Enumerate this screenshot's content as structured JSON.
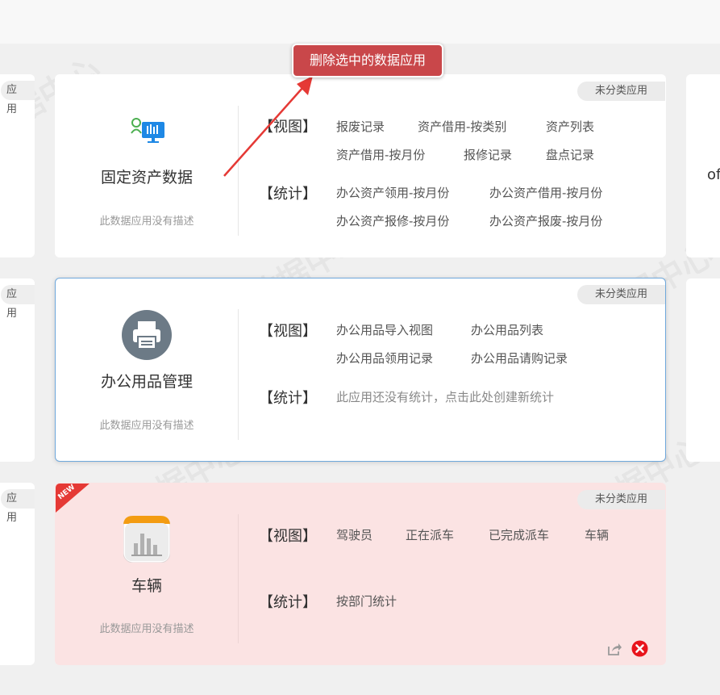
{
  "tooltip": {
    "label": "删除选中的数据应用"
  },
  "side": {
    "tag_partial": "应用",
    "right_text_partial": "of"
  },
  "watermark_text": "数据中心",
  "cards": [
    {
      "name": "固定资产数据",
      "desc": "此数据应用没有描述",
      "tag": "未分类应用",
      "view_label": "【视图】",
      "stat_label": "【统计】",
      "views": [
        "报废记录",
        "资产借用-按类别",
        "资产列表",
        "资产借用-按月份",
        "报修记录",
        "盘点记录"
      ],
      "stats": [
        "办公资产领用-按月份",
        "办公资产借用-按月份",
        "办公资产报修-按月份",
        "办公资产报废-按月份"
      ]
    },
    {
      "name": "办公用品管理",
      "desc": "此数据应用没有描述",
      "tag": "未分类应用",
      "view_label": "【视图】",
      "stat_label": "【统计】",
      "views": [
        "办公用品导入视图",
        "办公用品列表",
        "办公用品领用记录",
        "办公用品请购记录"
      ],
      "stats_empty": "此应用还没有统计，点击此处创建新统计"
    },
    {
      "name": "车辆",
      "desc": "此数据应用没有描述",
      "tag": "未分类应用",
      "view_label": "【视图】",
      "stat_label": "【统计】",
      "new_badge": "NEW",
      "views": [
        "驾驶员",
        "正在派车",
        "已完成派车",
        "车辆"
      ],
      "stats": [
        "按部门统计"
      ]
    }
  ],
  "colors": {
    "accent_red": "#c9474a",
    "pink_bg": "#fbe3e3",
    "selected_border": "#6fa8dc"
  }
}
